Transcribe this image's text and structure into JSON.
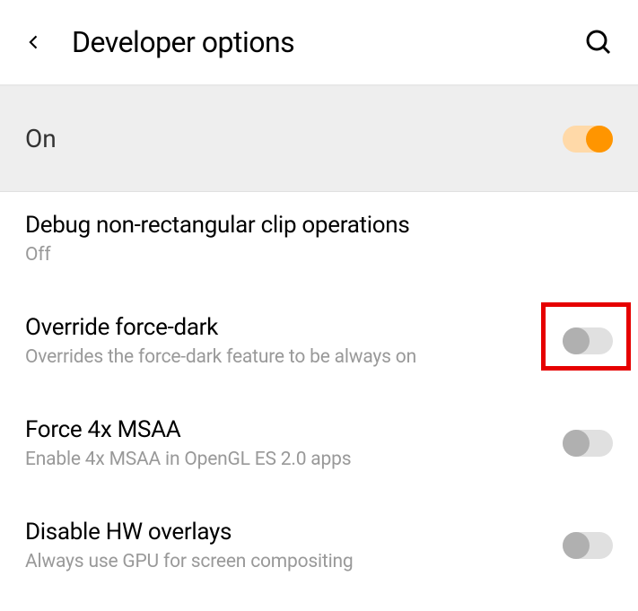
{
  "header": {
    "title": "Developer options"
  },
  "master_toggle": {
    "label": "On",
    "enabled": true
  },
  "settings": [
    {
      "title": "Debug non-rectangular clip operations",
      "subtitle": "Off",
      "has_toggle": false,
      "toggled": false,
      "highlighted": false
    },
    {
      "title": "Override force-dark",
      "subtitle": "Overrides the force-dark feature to be always on",
      "has_toggle": true,
      "toggled": false,
      "highlighted": true
    },
    {
      "title": "Force 4x MSAA",
      "subtitle": "Enable 4x MSAA in OpenGL ES 2.0 apps",
      "has_toggle": true,
      "toggled": false,
      "highlighted": false
    },
    {
      "title": "Disable HW overlays",
      "subtitle": "Always use GPU for screen compositing",
      "has_toggle": true,
      "toggled": false,
      "highlighted": false
    }
  ]
}
